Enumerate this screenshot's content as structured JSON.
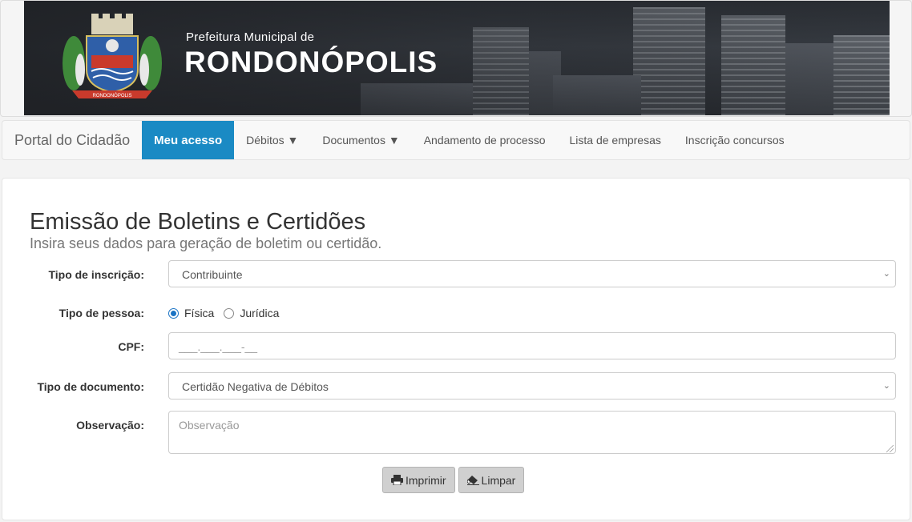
{
  "header": {
    "prefeitura": "Prefeitura Municipal de",
    "cidade": "RONDONÓPOLIS",
    "crest_text": "RONDONÓPOLIS"
  },
  "nav": {
    "brand": "Portal do Cidadão",
    "items": [
      {
        "label": "Meu acesso",
        "active": true
      },
      {
        "label": "Débitos ▼"
      },
      {
        "label": "Documentos ▼"
      },
      {
        "label": "Andamento de processo"
      },
      {
        "label": "Lista de empresas"
      },
      {
        "label": "Inscrição concursos"
      }
    ]
  },
  "form": {
    "title": "Emissão de Boletins e Certidões",
    "subtitle": "Insira seus dados para geração de boletim ou certidão.",
    "tipo_inscricao": {
      "label": "Tipo de inscrição:",
      "value": "Contribuinte"
    },
    "tipo_pessoa": {
      "label": "Tipo de pessoa:",
      "options": [
        "Física",
        "Jurídica"
      ],
      "selected": "Física"
    },
    "cpf": {
      "label": "CPF:",
      "placeholder": "___.___.___-__"
    },
    "tipo_documento": {
      "label": "Tipo de documento:",
      "value": "Certidão Negativa de Débitos"
    },
    "observacao": {
      "label": "Observação:",
      "placeholder": "Observação"
    },
    "buttons": {
      "imprimir": "Imprimir",
      "limpar": "Limpar"
    }
  },
  "colors": {
    "nav_active": "#1a8ac4",
    "radio_accent": "#1a73c4"
  },
  "icons": {
    "select_caret": "chevron-down-icon",
    "print": "printer-icon",
    "clear": "eraser-icon"
  }
}
